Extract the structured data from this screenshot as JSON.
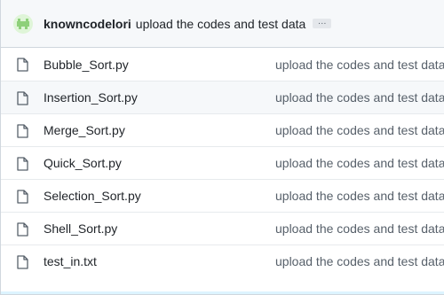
{
  "latest_commit": {
    "author": "knowncodelori",
    "message": "upload the codes and test data",
    "ellipsis_label": "…",
    "avatar_icon": "identicon-avatar",
    "avatar_color": "#8ed07a"
  },
  "files": [
    {
      "name": "Bubble_Sort.py",
      "commit": "upload the codes and test data",
      "icon": "file-icon"
    },
    {
      "name": "Insertion_Sort.py",
      "commit": "upload the codes and test data",
      "icon": "file-icon"
    },
    {
      "name": "Merge_Sort.py",
      "commit": "upload the codes and test data",
      "icon": "file-icon"
    },
    {
      "name": "Quick_Sort.py",
      "commit": "upload the codes and test data",
      "icon": "file-icon"
    },
    {
      "name": "Selection_Sort.py",
      "commit": "upload the codes and test data",
      "icon": "file-icon"
    },
    {
      "name": "Shell_Sort.py",
      "commit": "upload the codes and test data",
      "icon": "file-icon"
    },
    {
      "name": "test_in.txt",
      "commit": "upload the codes and test data",
      "icon": "file-icon"
    }
  ]
}
